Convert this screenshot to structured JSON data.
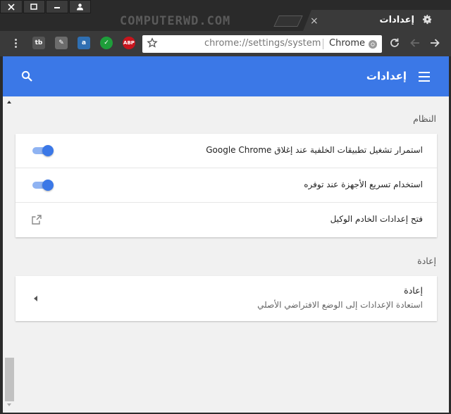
{
  "window": {
    "controls": [
      "close",
      "restore",
      "minimize",
      "user"
    ],
    "watermark": "COMPUTERWD.COM"
  },
  "tab": {
    "title": "إعدادات",
    "icon": "gear-icon",
    "close": "×"
  },
  "toolbar": {
    "extensions": [
      {
        "name": "tb-extension-icon",
        "label": "tb",
        "color": "#555555"
      },
      {
        "name": "pen-extension-icon",
        "label": "✎",
        "color": "#6c6c6c"
      },
      {
        "name": "amazon-extension-icon",
        "label": "a",
        "color": "#2f6fb2"
      },
      {
        "name": "checkmark-extension-icon",
        "label": "✓",
        "color": "#1e9e3a"
      },
      {
        "name": "adblock-extension-icon",
        "label": "ABP",
        "color": "#c8151d"
      }
    ],
    "omnibox": {
      "url": "chrome://settings/system",
      "chip_label": "Chrome"
    }
  },
  "appbar": {
    "title": "إعدادات",
    "color": "#3b78e7"
  },
  "sections": {
    "system": {
      "label": "النظام",
      "rows": [
        {
          "label": "استمرار تشغيل تطبيقات الخلفية عند إغلاق Google Chrome",
          "type": "toggle",
          "enabled": true
        },
        {
          "label": "استخدام تسريع الأجهزة عند توفره",
          "type": "toggle",
          "enabled": true
        },
        {
          "label": "فتح إعدادات الخادم الوكيل",
          "type": "external-link"
        }
      ]
    },
    "reset": {
      "label": "إعادة",
      "title": "إعادة",
      "description": "استعادة الإعدادات إلى الوضع الافتراضي الأصلي"
    }
  }
}
